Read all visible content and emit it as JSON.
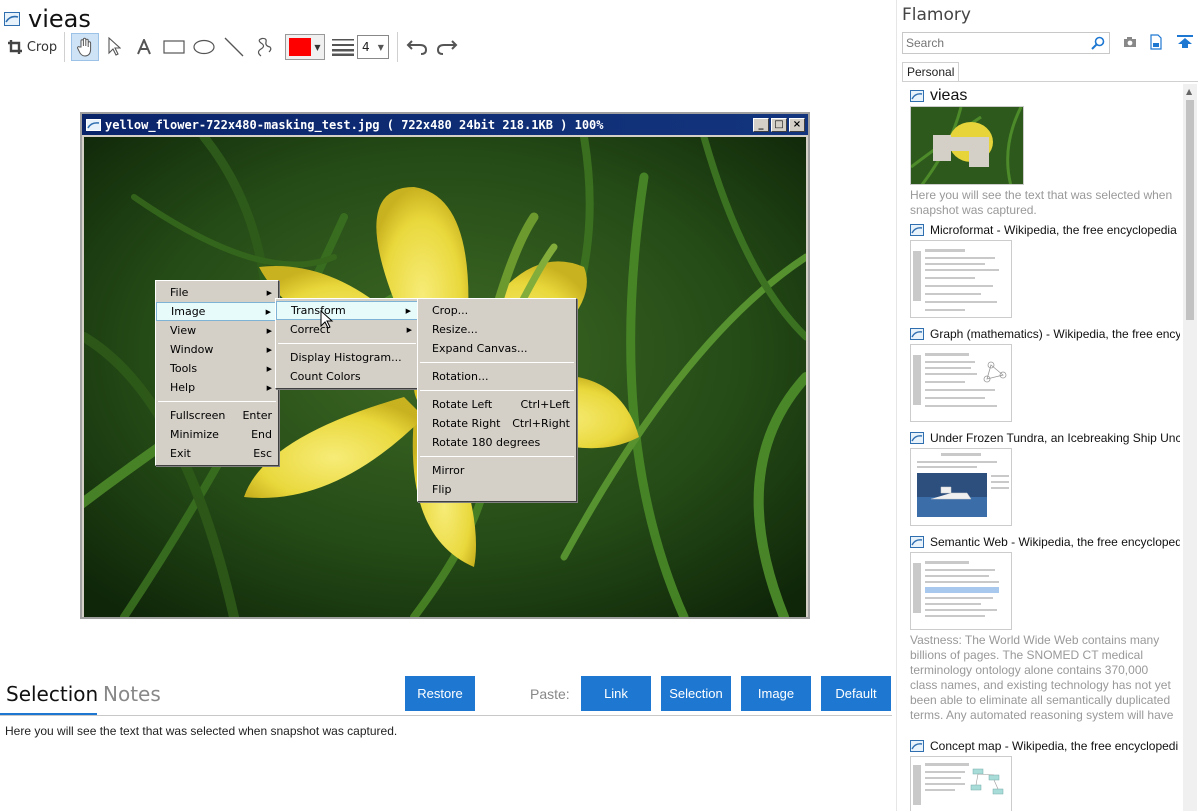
{
  "app": {
    "title": "vieas"
  },
  "toolbar": {
    "crop_label": "Crop",
    "line_width": "4",
    "color": "#ff0000"
  },
  "image_window": {
    "title": "yellow_flower-722x480-masking_test.jpg ( 722x480 24bit 218.1KB ) 100%",
    "controls": [
      "_",
      "□",
      "×"
    ]
  },
  "menus": {
    "main": {
      "items": [
        {
          "label": "File",
          "sub": "▶"
        },
        {
          "label": "Image",
          "sub": "▶"
        },
        {
          "label": "View",
          "sub": "▶"
        },
        {
          "label": "Window",
          "sub": "▶"
        },
        {
          "label": "Tools",
          "sub": "▶"
        },
        {
          "label": "Help",
          "sub": "▶"
        }
      ],
      "items2": [
        {
          "label": "Fullscreen",
          "shortcut": "Enter"
        },
        {
          "label": "Minimize",
          "shortcut": "End"
        },
        {
          "label": "Exit",
          "shortcut": "Esc"
        }
      ]
    },
    "image_sub": {
      "items": [
        {
          "label": "Transform",
          "sub": "▶"
        },
        {
          "label": "Correct",
          "sub": "▶"
        }
      ],
      "items2": [
        {
          "label": "Display Histogram..."
        },
        {
          "label": "Count Colors"
        }
      ]
    },
    "transform_sub": {
      "g1": [
        "Crop...",
        "Resize...",
        "Expand Canvas..."
      ],
      "g2": [
        "Rotation..."
      ],
      "g3": [
        {
          "label": "Rotate Left",
          "shortcut": "Ctrl+Left"
        },
        {
          "label": "Rotate Right",
          "shortcut": "Ctrl+Right"
        },
        {
          "label": "Rotate 180 degrees",
          "shortcut": ""
        }
      ],
      "g4": [
        "Mirror",
        "Flip"
      ]
    }
  },
  "bottom": {
    "tab_selection": "Selection",
    "tab_notes": "Notes",
    "restore": "Restore",
    "paste_label": "Paste:",
    "paste_buttons": [
      "Link",
      "Selection",
      "Image",
      "Default"
    ],
    "selection_text": "Here you will see the text that was selected when snapshot was captured."
  },
  "right_pane": {
    "title": "Flamory",
    "search_placeholder": "Search",
    "tab": "Personal",
    "snapshots": [
      {
        "title": "vieas",
        "desc": "Here you will see the text that was selected when snapshot was captured."
      },
      {
        "title": "Microformat - Wikipedia, the free encyclopedia",
        "desc": ""
      },
      {
        "title": "Graph (mathematics) - Wikipedia, the free ency",
        "desc": ""
      },
      {
        "title": "Under Frozen Tundra, an Icebreaking Ship Unco",
        "desc": ""
      },
      {
        "title": "Semantic Web - Wikipedia, the free encycloped",
        "desc": "Vastness: The World Wide Web contains many billions of pages. The SNOMED CT medical terminology ontology alone contains 370,000 class names, and existing technology has not yet been able to eliminate all semantically duplicated terms. Any automated reasoning system will have to deal with truly huge inputs."
      },
      {
        "title": "Concept map - Wikipedia, the free encyclopedi",
        "desc": ""
      }
    ]
  }
}
